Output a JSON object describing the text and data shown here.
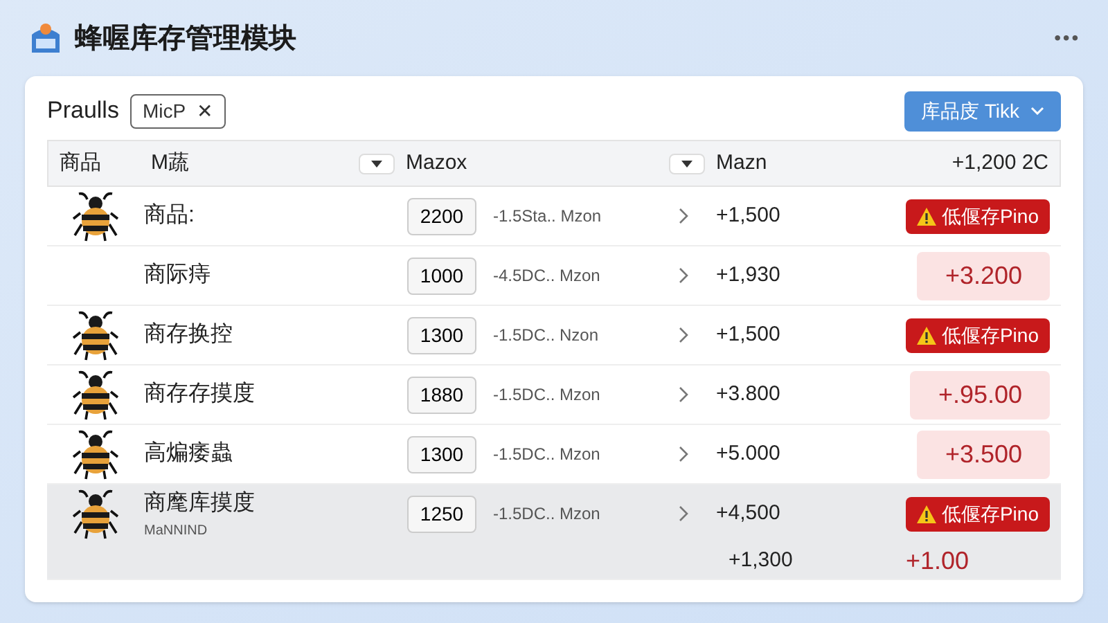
{
  "header": {
    "title": "蜂喔库存管理模块",
    "menu": "•••"
  },
  "toolbar": {
    "label": "Praulls",
    "chip": {
      "label": "MicP",
      "close": "✕"
    },
    "dropdown": "库品庋 Tikk"
  },
  "table": {
    "columns": [
      {
        "label": "商品",
        "kind": "text"
      },
      {
        "label": "M蔬",
        "kind": "text"
      },
      {
        "kind": "sort"
      },
      {
        "label": "Mazox",
        "kind": "text"
      },
      {
        "kind": "sort"
      },
      {
        "label": "Mazn",
        "kind": "text"
      },
      {
        "label": "+1,200 2C",
        "kind": "text"
      }
    ],
    "rows": [
      {
        "bee": true,
        "name": "商品:",
        "qty": "2200",
        "desc": "-1.5Sta.. Mzon",
        "value": "+1,500",
        "status": {
          "kind": "alert",
          "text": "低偃存Pino"
        },
        "selected": false
      },
      {
        "bee": false,
        "name": "商际痔",
        "qty": "1000",
        "desc": "-4.5DC.. Mzon",
        "value": "+1,930",
        "status": {
          "kind": "pill",
          "text": "+3.200"
        },
        "selected": false
      },
      {
        "bee": true,
        "name": "商存换控",
        "qty": "1300",
        "desc": "-1.5DC.. Nzon",
        "value": "+1,500",
        "status": {
          "kind": "alert",
          "text": "低偃存Pino"
        },
        "selected": false
      },
      {
        "bee": true,
        "name": "商存存摸度",
        "qty": "1880",
        "desc": "-1.5DC.. Mzon",
        "value": "+3.800",
        "status": {
          "kind": "pill",
          "text": "+.95.00"
        },
        "selected": false
      },
      {
        "bee": true,
        "name": "高煸痿蟲",
        "qty": "1300",
        "desc": "-1.5DC.. Mzon",
        "value": "+5.000",
        "status": {
          "kind": "pill",
          "text": "+3.500"
        },
        "selected": false
      },
      {
        "bee": true,
        "name": "商麾库摸度",
        "sub": "MaNNIND",
        "qty": "1250",
        "desc": "-1.5DC.. Mzon",
        "value": "+4,500",
        "status": {
          "kind": "alert",
          "text": "低偃存Pino"
        },
        "extra_value": "+1,300",
        "extra_status": "+1.00",
        "selected": true
      }
    ]
  }
}
